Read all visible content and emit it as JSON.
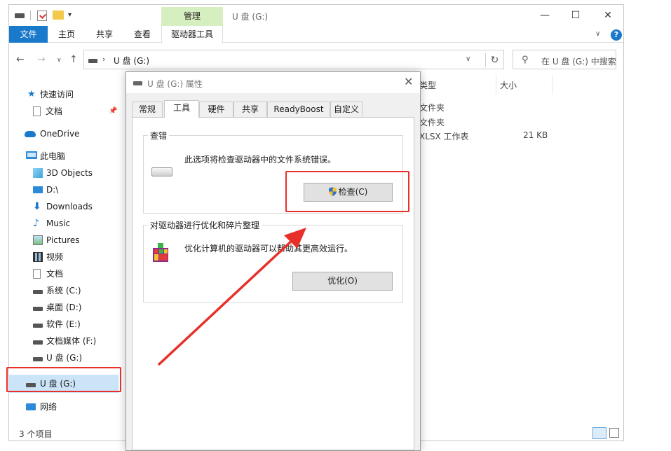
{
  "explorer": {
    "title": "U 盘 (G:)",
    "context_tab": "管理",
    "ribbon_tabs": {
      "file": "文件",
      "home": "主页",
      "share": "共享",
      "view": "查看",
      "drive_tools": "驱动器工具"
    },
    "address_text": "U 盘 (G:)",
    "search_placeholder": "在 U 盘 (G:) 中搜索",
    "status": "3 个项目"
  },
  "sidebar": {
    "items": [
      {
        "label": "快速访问",
        "icon": "star-icon"
      },
      {
        "label": "文档",
        "icon": "document-icon"
      },
      {
        "label": "OneDrive",
        "icon": "cloud-icon"
      },
      {
        "label": "此电脑",
        "icon": "computer-icon"
      },
      {
        "label": "3D Objects",
        "icon": "cube-icon"
      },
      {
        "label": "D:\\",
        "icon": "monitor-icon"
      },
      {
        "label": "Downloads",
        "icon": "download-icon"
      },
      {
        "label": "Music",
        "icon": "music-icon"
      },
      {
        "label": "Pictures",
        "icon": "pictures-icon"
      },
      {
        "label": "视频",
        "icon": "video-icon"
      },
      {
        "label": "文档",
        "icon": "document-icon"
      },
      {
        "label": "系统 (C:)",
        "icon": "drive-icon"
      },
      {
        "label": "桌面 (D:)",
        "icon": "drive-icon"
      },
      {
        "label": "软件 (E:)",
        "icon": "drive-icon"
      },
      {
        "label": "文档媒体 (F:)",
        "icon": "drive-icon"
      },
      {
        "label": "U 盘 (G:)",
        "icon": "drive-icon"
      },
      {
        "label": "U 盘 (G:)",
        "icon": "drive-icon"
      },
      {
        "label": "网络",
        "icon": "network-icon"
      }
    ]
  },
  "file_list": {
    "columns": {
      "type": "类型",
      "size": "大小"
    },
    "rows": [
      {
        "type": "文件夹",
        "size": ""
      },
      {
        "type": "文件夹",
        "size": ""
      },
      {
        "type": "XLSX 工作表",
        "size": "21 KB"
      }
    ]
  },
  "dialog": {
    "title": "U 盘 (G:) 属性",
    "tabs": {
      "general": "常规",
      "tools": "工具",
      "hardware": "硬件",
      "sharing": "共享",
      "readyboost": "ReadyBoost",
      "custom": "自定义"
    },
    "check_group": {
      "title": "查错",
      "description": "此选项将检查驱动器中的文件系统错误。",
      "button": "检查(C)"
    },
    "optimize_group": {
      "title": "对驱动器进行优化和碎片整理",
      "description": "优化计算机的驱动器可以帮助其更高效运行。",
      "button": "优化(O)"
    }
  },
  "colors": {
    "accent": "#1979ca",
    "annotation": "#e8302a",
    "manage_tab": "#d6efc0"
  }
}
